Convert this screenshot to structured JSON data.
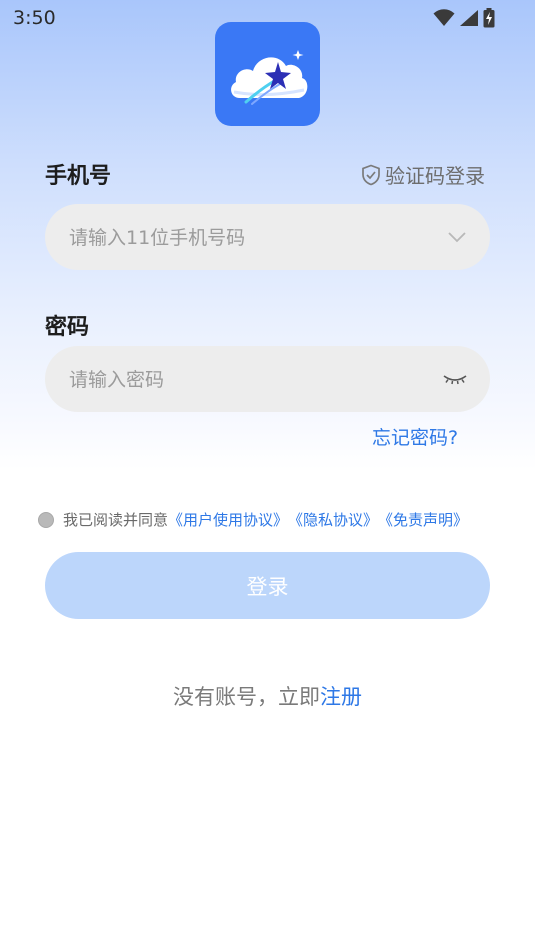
{
  "status_bar": {
    "time": "3:50",
    "icons": [
      "wifi-icon",
      "cellular-signal-icon",
      "battery-charging-icon"
    ]
  },
  "app": {
    "icon": "cloud-shooting-star-logo",
    "accent_color": "#3a78f5"
  },
  "form": {
    "phone_label": "手机号",
    "sms_login_label": "验证码登录",
    "phone_placeholder": "请输入11位手机号码",
    "password_label": "密码",
    "password_placeholder": "请输入密码",
    "forgot_password": "忘记密码?"
  },
  "agreement": {
    "prefix": "我已阅读并同意",
    "user_agreement": "《用户使用协议》",
    "privacy": "《隐私协议》",
    "disclaimer": "《免责声明》",
    "checked": false
  },
  "login_button": "登录",
  "register": {
    "prompt": "没有账号，立即",
    "link": "注册"
  },
  "colors": {
    "link": "#2e78e6",
    "button_disabled": "#bcd6fb",
    "field_background": "#ededed"
  }
}
